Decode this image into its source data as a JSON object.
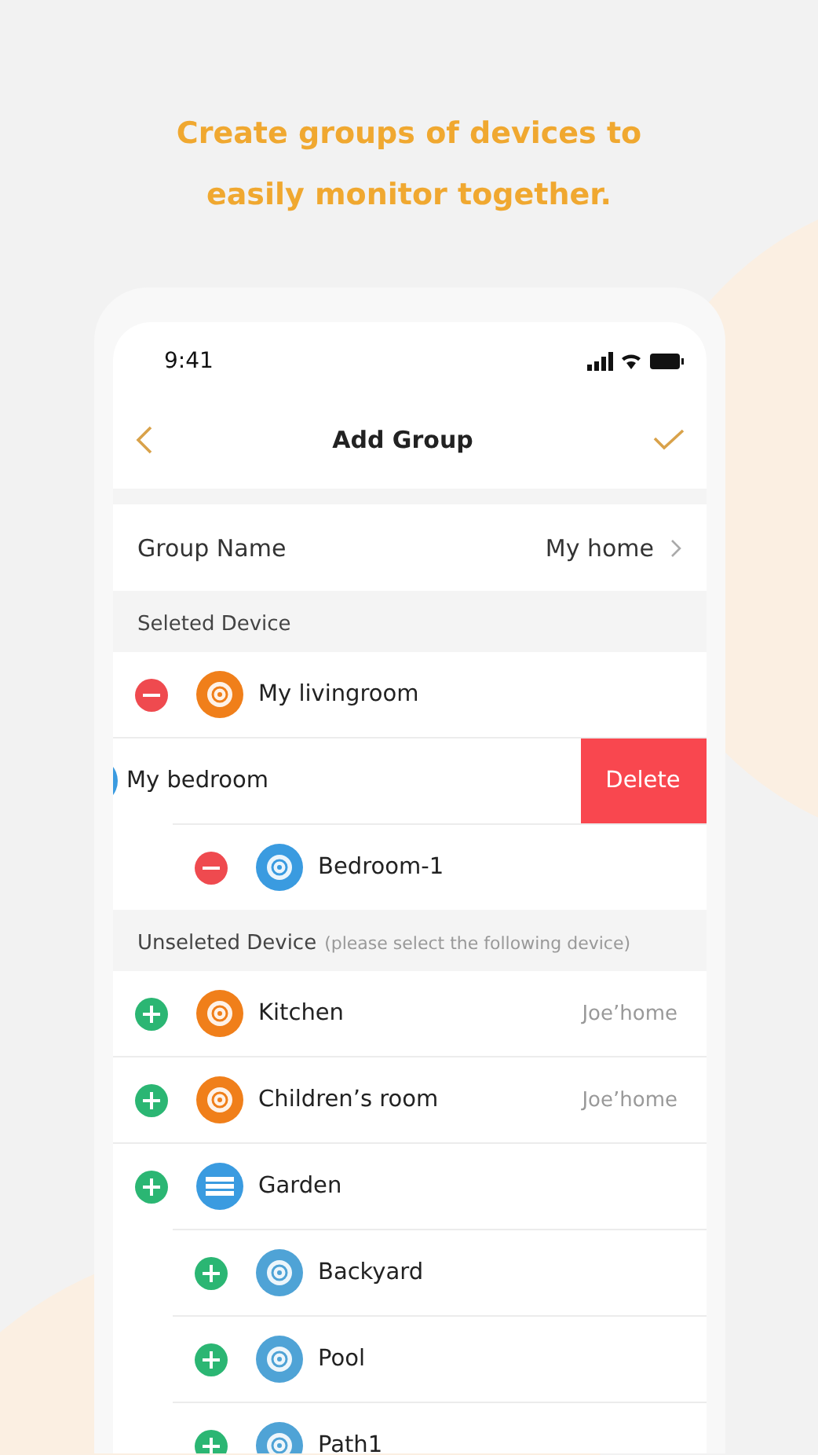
{
  "heading": "Create groups of devices to easily monitor together.",
  "status_bar": {
    "time": "9:41"
  },
  "nav": {
    "title": "Add Group"
  },
  "group_name": {
    "label": "Group Name",
    "value": "My home"
  },
  "sections": [
    {
      "title": "Seleted Device",
      "kind": "selected",
      "items": [
        {
          "name": "My livingroom",
          "kind": "device",
          "color": "#f07f1a",
          "swiped": false
        },
        {
          "name": "My bedroom",
          "kind": "device",
          "color": "#3a9be0",
          "swiped": true,
          "delete_label": "Delete",
          "children": [
            {
              "name": "Bedroom-1",
              "kind": "device",
              "color": "#3a9be0",
              "swiped": false
            }
          ]
        }
      ]
    },
    {
      "title": "Unseleted Device",
      "hint": "(please select the following device)",
      "kind": "unselected",
      "items": [
        {
          "name": "Kitchen",
          "kind": "device",
          "color": "#f07f1a",
          "swiped": false,
          "home": "Joe’home"
        },
        {
          "name": "Children’s room",
          "kind": "device",
          "color": "#f07f1a",
          "swiped": false,
          "home": "Joe’home"
        },
        {
          "name": "Garden",
          "kind": "group",
          "color": "#3a9be0",
          "swiped": false,
          "children": [
            {
              "name": "Backyard",
              "kind": "device",
              "color": "#4fa3d6",
              "swiped": false
            },
            {
              "name": "Pool",
              "kind": "device",
              "color": "#4fa3d6",
              "swiped": false
            },
            {
              "name": "Path1",
              "kind": "device",
              "color": "#4fa3d6",
              "swiped": false
            }
          ]
        }
      ]
    }
  ]
}
